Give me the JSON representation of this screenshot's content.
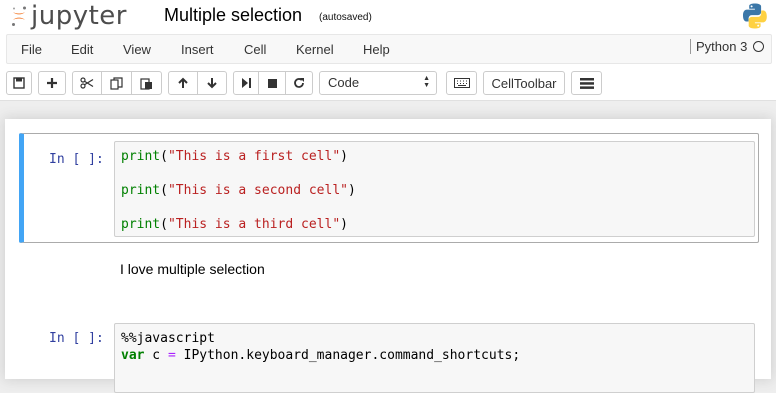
{
  "header": {
    "logo_text": "jupyter",
    "notebook_title": "Multiple selection",
    "autosave_status": "(autosaved)"
  },
  "menubar": {
    "items": [
      "File",
      "Edit",
      "View",
      "Insert",
      "Cell",
      "Kernel",
      "Help"
    ],
    "kernel_name": "Python 3"
  },
  "toolbar": {
    "buttons": [
      "save-icon",
      "plus-icon",
      "cut-icon",
      "copy-icon",
      "paste-icon",
      "arrow-up-icon",
      "arrow-down-icon",
      "step-forward-icon",
      "stop-icon",
      "refresh-icon",
      "keyboard-icon",
      "list-icon"
    ],
    "cell_type": "Code",
    "celltoolbar_label": "CellToolbar"
  },
  "cells": [
    {
      "prompt": "In [ ]:",
      "lines": [
        {
          "fn": "print",
          "open": "(",
          "str": "\"This is a first cell\"",
          "close": ")"
        },
        {
          "fn": "print",
          "open": "(",
          "str": "\"This is a second cell\"",
          "close": ")"
        },
        {
          "fn": "print",
          "open": "(",
          "str": "\"This is a third cell\"",
          "close": ")"
        }
      ]
    },
    {
      "markdown": "I love multiple selection"
    },
    {
      "prompt": "In [ ]:",
      "line1": "%%javascript",
      "line2_kw": "var",
      "line2_var": " c ",
      "line2_op": "=",
      "line2_rest": " IPython.keyboard_manager.command_shortcuts;"
    }
  ],
  "colors": {
    "selected_cell_border": "#42a5f5",
    "prompt": "#303f9f",
    "string": "#ba2121",
    "keyword": "#008000"
  }
}
